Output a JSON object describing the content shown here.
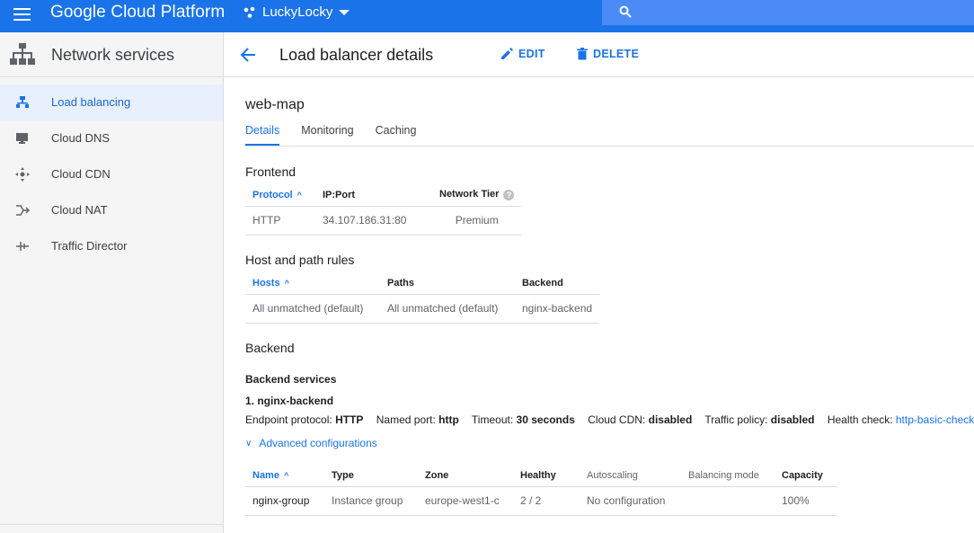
{
  "topbar": {
    "brand": "Google Cloud Platform",
    "project": "LuckyLocky",
    "search_placeholder": ""
  },
  "sidebar": {
    "title": "Network services",
    "items": [
      {
        "label": "Load balancing",
        "icon": "load-balancing-icon",
        "active": true
      },
      {
        "label": "Cloud DNS",
        "icon": "cloud-dns-icon",
        "active": false
      },
      {
        "label": "Cloud CDN",
        "icon": "cloud-cdn-icon",
        "active": false
      },
      {
        "label": "Cloud NAT",
        "icon": "cloud-nat-icon",
        "active": false
      },
      {
        "label": "Traffic Director",
        "icon": "traffic-director-icon",
        "active": false
      }
    ]
  },
  "header": {
    "title": "Load balancer details",
    "edit": "EDIT",
    "delete": "DELETE"
  },
  "lb_name": "web-map",
  "tabs": [
    "Details",
    "Monitoring",
    "Caching"
  ],
  "frontend": {
    "title": "Frontend",
    "columns": [
      "Protocol",
      "IP:Port",
      "Network Tier"
    ],
    "rows": [
      [
        "HTTP",
        "34.107.186.31:80",
        "Premium"
      ]
    ]
  },
  "host_path": {
    "title": "Host and path rules",
    "columns": [
      "Hosts",
      "Paths",
      "Backend"
    ],
    "rows": [
      [
        "All unmatched (default)",
        "All unmatched (default)",
        "nginx-backend"
      ]
    ]
  },
  "backend": {
    "title": "Backend",
    "services_title": "Backend services",
    "service_name": "1. nginx-backend",
    "props": {
      "endpoint_label": "Endpoint protocol:",
      "endpoint_value": "HTTP",
      "port_label": "Named port:",
      "port_value": "http",
      "timeout_label": "Timeout:",
      "timeout_value": "30 seconds",
      "cdn_label": "Cloud CDN:",
      "cdn_value": "disabled",
      "traffic_label": "Traffic policy:",
      "traffic_value": "disabled",
      "health_label": "Health check:",
      "health_value": "http-basic-check"
    },
    "advanced": "Advanced configurations",
    "columns": [
      "Name",
      "Type",
      "Zone",
      "Healthy",
      "Autoscaling",
      "Balancing mode",
      "Capacity"
    ],
    "rows": [
      [
        "nginx-group",
        "Instance group",
        "europe-west1-c",
        "2 / 2",
        "No configuration",
        "",
        "100%"
      ]
    ]
  },
  "colors": {
    "accent": "#1a73e8",
    "topbar": "#1a73e8"
  }
}
